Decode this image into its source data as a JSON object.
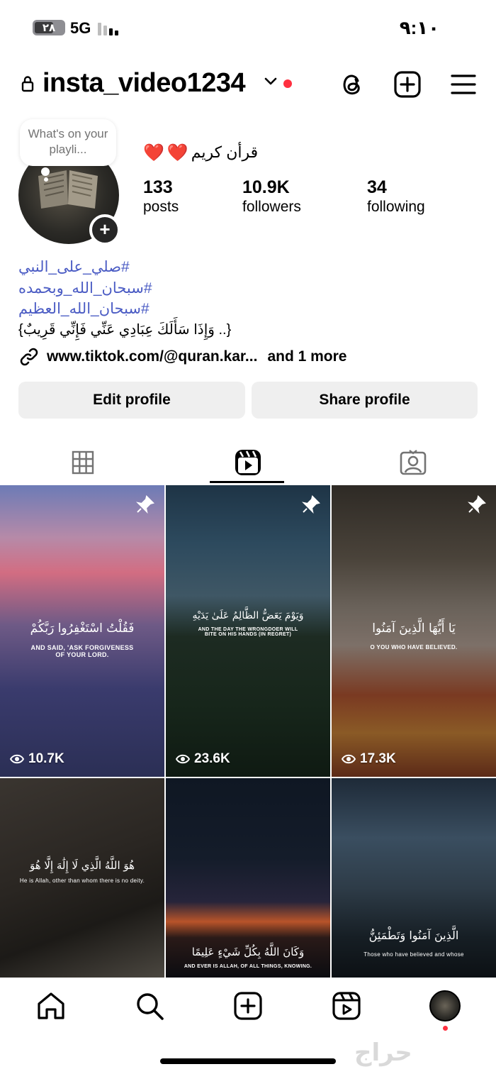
{
  "status_bar": {
    "battery": "٢٨",
    "network": "5G",
    "time": "٩:١٠"
  },
  "header": {
    "username": "insta_video1234",
    "icons": [
      "lock-icon",
      "chevron-down-icon",
      "threads-icon",
      "create-icon",
      "menu-icon"
    ]
  },
  "profile": {
    "note": "What's on your playli...",
    "display_name": "قرأن كريم",
    "stats": {
      "posts": {
        "value": "133",
        "label": "posts"
      },
      "followers": {
        "value": "10.9K",
        "label": "followers"
      },
      "following": {
        "value": "34",
        "label": "following"
      }
    },
    "bio": {
      "hashtags": [
        "#صلي_على_النبي",
        "#سبحان_الله_وبحمده",
        "#سبحان_الله_العظيم"
      ],
      "quote": "{وَإِذَا سَأَلَكَ عِبَادِي عَنِّي فَإِنِّي قَرِيبٌ ..}",
      "link": "www.tiktok.com/@quran.kar...",
      "link_more": "and 1 more"
    },
    "buttons": {
      "edit": "Edit profile",
      "share": "Share profile"
    }
  },
  "tabs": {
    "active": "reels",
    "items": [
      "grid-icon",
      "reels-icon",
      "tagged-icon"
    ]
  },
  "reels": [
    {
      "views": "10.7K",
      "pinned": true,
      "arabic": "فَقُلْتُ اسْتَغْفِرُوا رَبَّكُمْ",
      "english": "AND SAID, 'ASK FORGIVENESS\nOF YOUR LORD."
    },
    {
      "views": "23.6K",
      "pinned": true,
      "arabic": "وَيَوْمَ يَعَضُّ الظَّالِمُ عَلَىٰ يَدَيْهِ",
      "english": "AND THE DAY THE WRONGDOER WILL\nBITE ON HIS HANDS (IN REGRET)"
    },
    {
      "views": "17.3K",
      "pinned": true,
      "arabic": "يَا أَيُّهَا الَّذِينَ آمَنُوا",
      "english": "O YOU WHO HAVE BELIEVED."
    },
    {
      "views": "",
      "pinned": false,
      "arabic": "هُوَ اللَّهُ الَّذِي لَا إِلَٰهَ إِلَّا هُوَ",
      "english": "He is Allah, other than whom there is no deity."
    },
    {
      "views": "",
      "pinned": false,
      "arabic": "وَكَانَ اللَّهُ بِكُلِّ شَيْءٍ عَلِيمًا",
      "english": "AND EVER IS ALLAH, OF ALL THINGS, KNOWING."
    },
    {
      "views": "",
      "pinned": false,
      "arabic": "الَّذِينَ آمَنُوا وَتَطْمَئِنُّ",
      "english": "Those who have believed and whose"
    }
  ],
  "bottom_nav": {
    "items": [
      "home-icon",
      "search-icon",
      "create-icon",
      "reels-icon",
      "profile-avatar"
    ]
  },
  "watermark": "حراج",
  "colors": {
    "hashtag": "#4b5cc4",
    "notification_dot": "#ff3040",
    "button_bg": "#efefef"
  }
}
